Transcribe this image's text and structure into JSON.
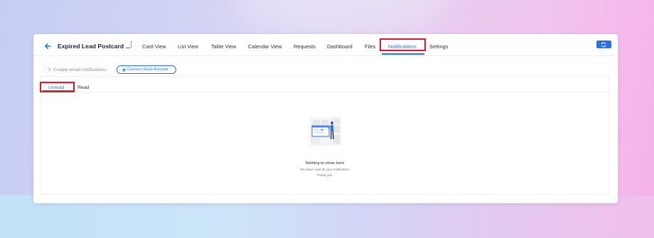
{
  "header": {
    "title": "Expired Lead Postcard ...",
    "tabs": [
      {
        "label": "Card View"
      },
      {
        "label": "List View"
      },
      {
        "label": "Table View"
      },
      {
        "label": "Calendar View"
      },
      {
        "label": "Requests"
      },
      {
        "label": "Dashboard"
      },
      {
        "label": "Files"
      },
      {
        "label": "Notifications",
        "active": true
      },
      {
        "label": "Settings"
      }
    ],
    "icons": {
      "back": "arrow-left-icon",
      "menu": "kebab-vertical-icon",
      "refresh": "refresh-icon"
    }
  },
  "settings_row": {
    "email_toggle_label": "Enable email notifications",
    "email_toggle_on": false,
    "slack_button_label": "Connect Slack Account",
    "slack_icon": "slack-icon"
  },
  "notifications": {
    "tabs": [
      {
        "label": "Unread",
        "active": true
      },
      {
        "label": "Read"
      }
    ],
    "empty_state": {
      "title": "Nothing to show here",
      "subtitle": "You have read all your notification.",
      "thanks": "Thank you.",
      "illustration": "empty-board-illustration"
    }
  },
  "colors": {
    "accent": "#2f6fe0",
    "highlight_box": "#e0162b"
  }
}
